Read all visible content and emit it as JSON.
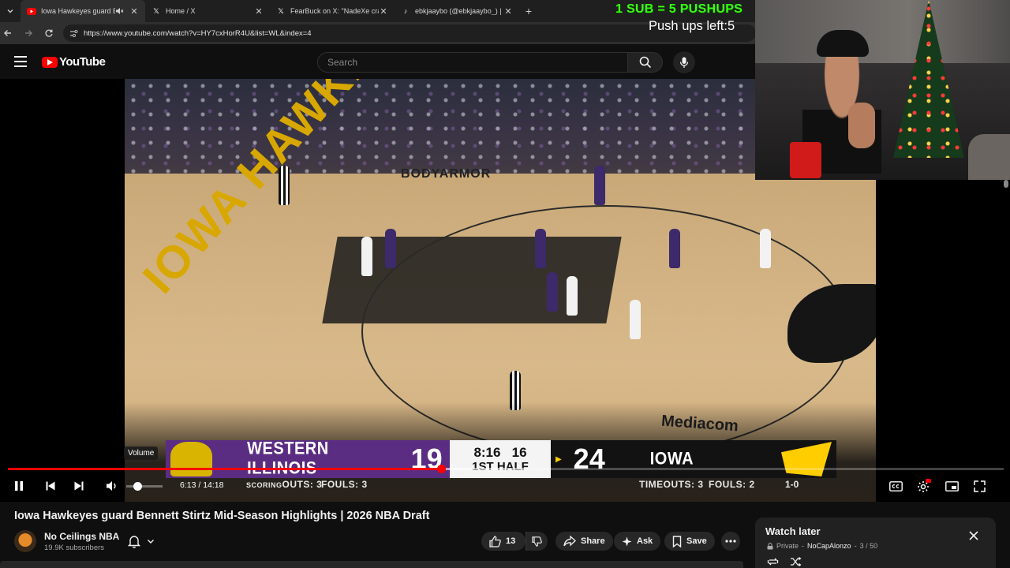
{
  "browser": {
    "tabs": [
      {
        "title": "Iowa Hawkeyes guard Benn",
        "icon": "youtube-favicon",
        "active": true,
        "muted": true
      },
      {
        "title": "Home / X",
        "icon": "x-favicon",
        "active": false
      },
      {
        "title": "FearBuck on X: \"NadeXe crashe",
        "icon": "x-favicon",
        "active": false
      },
      {
        "title": "ebkjaaybo (@ebkjaaybo_) | Tik",
        "icon": "tiktok-favicon",
        "active": false
      }
    ],
    "url": "https://www.youtube.com/watch?v=HY7cxHorR4U&list=WL&index=4"
  },
  "youtube": {
    "logo_text": "YouTube",
    "search_placeholder": "Search"
  },
  "scoreboard": {
    "away_team": "WESTERN ILLINOIS",
    "away_score": "19",
    "clock": "8:16",
    "shot_clock": "16",
    "period": "1ST HALF",
    "home_score": "24",
    "home_team": "IOWA",
    "away_timeouts_text": "SCORING",
    "away_timeouts_overlap": "OUTS: 3",
    "away_fouls": "FOULS: 3",
    "home_timeouts": "TIMEOUTS: 3",
    "home_fouls": "FOULS: 2",
    "home_record": "1-0"
  },
  "player": {
    "current_time": "6:13",
    "duration": "14:18",
    "timecode_text": "6:13 / 14:18",
    "volume_tooltip": "Volume",
    "progress_fraction": 0.435,
    "buffered_fraction": 0.52,
    "volume_fraction": 0.2
  },
  "video": {
    "title": "Iowa Hawkeyes guard Bennett Stirtz Mid-Season Highlights | 2026 NBA Draft",
    "channel_name": "No Ceilings NBA",
    "channel_subs": "19.9K subscribers",
    "likes": "13",
    "share_label": "Share",
    "ask_label": "Ask",
    "save_label": "Save"
  },
  "watch_later": {
    "title": "Watch later",
    "privacy": "Private",
    "owner": "NoCapAlonzo",
    "position": "3 / 50"
  },
  "overlay": {
    "pushup_banner": "1 SUB = 5 PUSHUPS",
    "pushups_left": "Push ups left:5"
  },
  "colors": {
    "youtube_red": "#ff0000",
    "banner_green": "#39ff14",
    "wiu_purple": "#5a2d82",
    "iowa_gold": "#ffcd00"
  }
}
